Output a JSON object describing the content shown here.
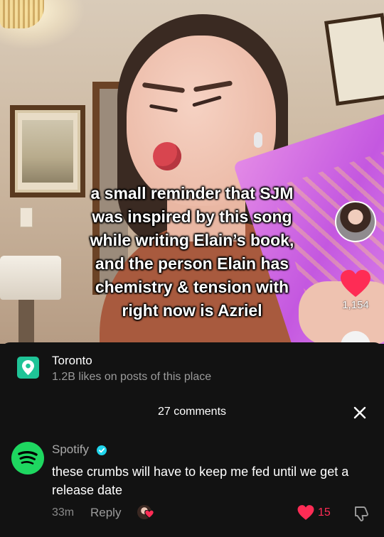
{
  "video": {
    "caption_lines": [
      "a small reminder that SJM",
      "was inspired by this song",
      "while writing Elain’s book,",
      "and the person Elain has",
      "chemistry & tension with",
      "right now is Azriel"
    ],
    "like_count": "1,154",
    "icons": [
      "creator-avatar",
      "heart-icon"
    ]
  },
  "location": {
    "name": "Toronto",
    "subtitle": "1.2B likes on posts of this place",
    "icon": "location-pin-icon"
  },
  "comments_header": {
    "count_label": "27 comments",
    "close_icon": "close-icon"
  },
  "comment": {
    "user": "Spotify",
    "verified": true,
    "text": "these crumbs will have to keep me fed until we get a release date",
    "time": "33m",
    "reply_label": "Reply",
    "likes": "15",
    "colors": {
      "spotify_green": "#1ed760",
      "like_red": "#fe2c55",
      "verified_blue": "#20d5ec"
    }
  }
}
